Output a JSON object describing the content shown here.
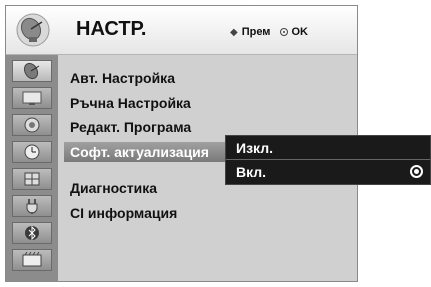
{
  "header": {
    "title": "НАСТР.",
    "hint_move": "Прем",
    "hint_ok": "OK"
  },
  "sidebar": {
    "icons": [
      "satellite-dish-icon",
      "tv-screen-icon",
      "speaker-icon",
      "clock-icon",
      "lock-icon",
      "input-plug-icon",
      "bluetooth-icon",
      "media-icon"
    ],
    "active_index": 0
  },
  "menu": {
    "items": [
      {
        "label": "Авт. Настройка"
      },
      {
        "label": "Ръчна Настройка"
      },
      {
        "label": "Редакт. Програма"
      },
      {
        "label": "Софт. актуализация"
      },
      {
        "label": "Диагностика"
      },
      {
        "label": "CI информация"
      }
    ],
    "selected_index": 3
  },
  "popup": {
    "options": [
      {
        "label": "Изкл.",
        "selected": false
      },
      {
        "label": "Вкл.",
        "selected": true
      }
    ]
  },
  "colors": {
    "panel_bg": "#d0d0d0",
    "sidebar_bg": "#8c8c8c",
    "popup_bg": "#1a1a1a",
    "highlight": "#8a8a8a"
  }
}
